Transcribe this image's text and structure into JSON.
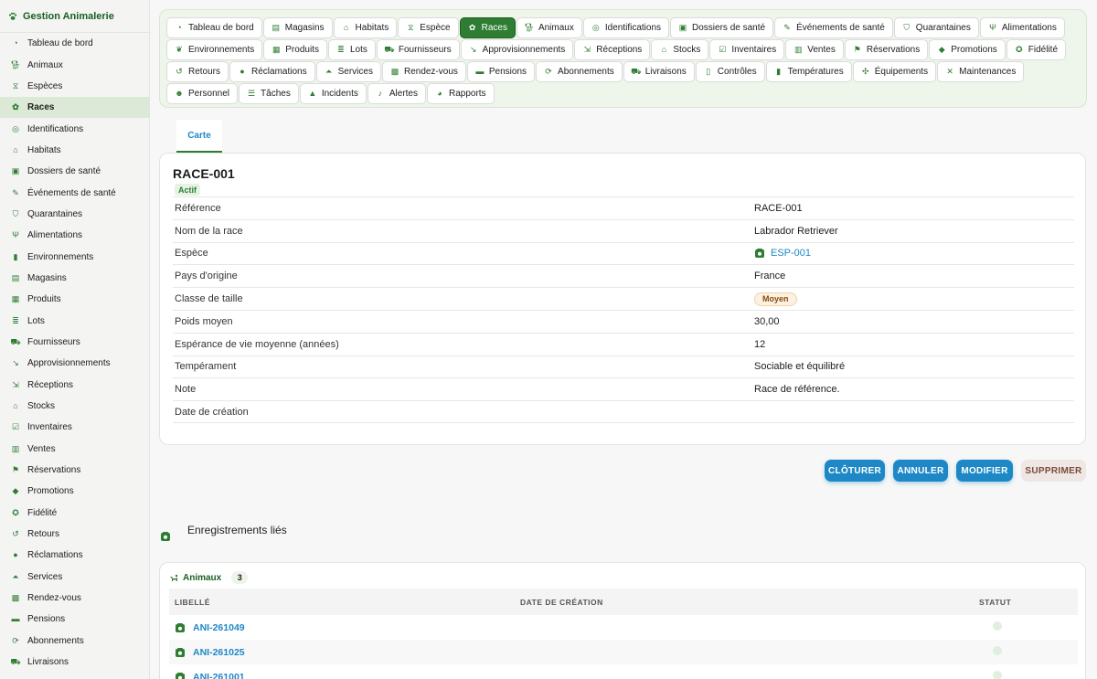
{
  "app": {
    "title": "Gestion Animalerie"
  },
  "sidebar": {
    "items": [
      {
        "label": "Tableau de bord",
        "icon": "dashboard-icon"
      },
      {
        "label": "Animaux",
        "icon": "dog-icon"
      },
      {
        "label": "Espèces",
        "icon": "dna-icon"
      },
      {
        "label": "Races",
        "icon": "paw-icon",
        "active": true
      },
      {
        "label": "Identifications",
        "icon": "fingerprint-icon"
      },
      {
        "label": "Habitats",
        "icon": "house-icon"
      },
      {
        "label": "Dossiers de santé",
        "icon": "medical-file-icon"
      },
      {
        "label": "Événements de santé",
        "icon": "syringe-icon"
      },
      {
        "label": "Quarantaines",
        "icon": "shield-icon"
      },
      {
        "label": "Alimentations",
        "icon": "utensils-icon"
      },
      {
        "label": "Environnements",
        "icon": "thermometer-icon"
      },
      {
        "label": "Magasins",
        "icon": "store-icon"
      },
      {
        "label": "Produits",
        "icon": "box-icon"
      },
      {
        "label": "Lots",
        "icon": "layers-icon"
      },
      {
        "label": "Fournisseurs",
        "icon": "truck-icon"
      },
      {
        "label": "Approvisionnements",
        "icon": "dolly-icon"
      },
      {
        "label": "Réceptions",
        "icon": "receive-icon"
      },
      {
        "label": "Stocks",
        "icon": "warehouse-icon"
      },
      {
        "label": "Inventaires",
        "icon": "clipboard-check-icon"
      },
      {
        "label": "Ventes",
        "icon": "cash-register-icon"
      },
      {
        "label": "Réservations",
        "icon": "bookmark-icon"
      },
      {
        "label": "Promotions",
        "icon": "tags-icon"
      },
      {
        "label": "Fidélité",
        "icon": "award-icon"
      },
      {
        "label": "Retours",
        "icon": "undo-icon"
      },
      {
        "label": "Réclamations",
        "icon": "comment-icon"
      },
      {
        "label": "Services",
        "icon": "bell-concierge-icon"
      },
      {
        "label": "Rendez-vous",
        "icon": "calendar-check-icon"
      },
      {
        "label": "Pensions",
        "icon": "bed-icon"
      },
      {
        "label": "Abonnements",
        "icon": "sync-icon"
      },
      {
        "label": "Livraisons",
        "icon": "shipping-icon"
      }
    ]
  },
  "topnav": {
    "items": [
      {
        "label": "Tableau de bord",
        "icon": "dashboard-icon"
      },
      {
        "label": "Magasins",
        "icon": "store-icon"
      },
      {
        "label": "Habitats",
        "icon": "house-icon"
      },
      {
        "label": "Espèce",
        "icon": "dna-icon"
      },
      {
        "label": "Races",
        "icon": "paw-icon",
        "active": true
      },
      {
        "label": "Animaux",
        "icon": "dog-icon"
      },
      {
        "label": "Identifications",
        "icon": "fingerprint-icon"
      },
      {
        "label": "Dossiers de santé",
        "icon": "medical-file-icon"
      },
      {
        "label": "Événements de santé",
        "icon": "syringe-icon"
      },
      {
        "label": "Quarantaines",
        "icon": "shield-icon"
      },
      {
        "label": "Alimentations",
        "icon": "utensils-icon"
      },
      {
        "label": "Environnements",
        "icon": "leaf-icon"
      },
      {
        "label": "Produits",
        "icon": "box-icon"
      },
      {
        "label": "Lots",
        "icon": "layers-icon"
      },
      {
        "label": "Fournisseurs",
        "icon": "truck-icon"
      },
      {
        "label": "Approvisionnements",
        "icon": "dolly-icon"
      },
      {
        "label": "Réceptions",
        "icon": "receive-icon"
      },
      {
        "label": "Stocks",
        "icon": "warehouse-icon"
      },
      {
        "label": "Inventaires",
        "icon": "clipboard-check-icon"
      },
      {
        "label": "Ventes",
        "icon": "cash-register-icon"
      },
      {
        "label": "Réservations",
        "icon": "bookmark-icon"
      },
      {
        "label": "Promotions",
        "icon": "tags-icon"
      },
      {
        "label": "Fidélité",
        "icon": "award-icon"
      },
      {
        "label": "Retours",
        "icon": "undo-icon"
      },
      {
        "label": "Réclamations",
        "icon": "comment-icon"
      },
      {
        "label": "Services",
        "icon": "bell-concierge-icon"
      },
      {
        "label": "Rendez-vous",
        "icon": "calendar-check-icon"
      },
      {
        "label": "Pensions",
        "icon": "bed-icon"
      },
      {
        "label": "Abonnements",
        "icon": "sync-icon"
      },
      {
        "label": "Livraisons",
        "icon": "shipping-icon"
      },
      {
        "label": "Contrôles",
        "icon": "clipboard-icon"
      },
      {
        "label": "Températures",
        "icon": "thermometer-icon"
      },
      {
        "label": "Équipements",
        "icon": "tools-icon"
      },
      {
        "label": "Maintenances",
        "icon": "wrench-icon"
      },
      {
        "label": "Personnel",
        "icon": "users-icon"
      },
      {
        "label": "Tâches",
        "icon": "tasks-icon"
      },
      {
        "label": "Incidents",
        "icon": "warning-icon"
      },
      {
        "label": "Alertes",
        "icon": "bell-icon"
      },
      {
        "label": "Rapports",
        "icon": "chart-pie-icon"
      }
    ]
  },
  "view": {
    "tab_label": "Carte"
  },
  "record": {
    "title": "RACE-001",
    "status": "Actif",
    "fields": [
      {
        "label": "Référence",
        "value": "RACE-001"
      },
      {
        "label": "Nom de la race",
        "value": "Labrador Retriever"
      },
      {
        "label": "Espèce",
        "value": "ESP-001",
        "type": "link"
      },
      {
        "label": "Pays d'origine",
        "value": "France"
      },
      {
        "label": "Classe de taille",
        "value": "Moyen",
        "type": "pill"
      },
      {
        "label": "Poids moyen",
        "value": "30,00"
      },
      {
        "label": "Espérance de vie moyenne (années)",
        "value": "12"
      },
      {
        "label": "Tempérament",
        "value": "Sociable et équilibré"
      },
      {
        "label": "Note",
        "value": "Race de référence."
      },
      {
        "label": "Date de création",
        "value": ""
      }
    ]
  },
  "actions": {
    "close_label": "CLÔTURER",
    "cancel_label": "ANNULER",
    "edit_label": "MODIFIER",
    "delete_label": "SUPPRIMER"
  },
  "linked": {
    "title": "Enregistrements liés",
    "panel_title": "Animaux",
    "count": "3",
    "columns": [
      "LIBELLÉ",
      "DATE DE CRÉATION",
      "STATUT"
    ],
    "rows": [
      {
        "label": "ANI-261049",
        "date": ""
      },
      {
        "label": "ANI-261025",
        "date": ""
      },
      {
        "label": "ANI-261001",
        "date": ""
      }
    ]
  },
  "colors": {
    "primary_green": "#2e7d32",
    "link_blue": "#1e88c7",
    "nav_bg": "#eef5eb"
  }
}
